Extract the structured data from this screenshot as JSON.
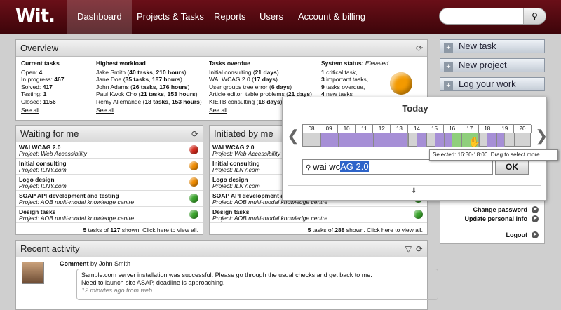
{
  "header": {
    "logo": "Wit.",
    "nav": [
      "Dashboard",
      "Projects & Tasks",
      "Reports",
      "Users",
      "Account & billing"
    ],
    "active_nav": "Dashboard",
    "search_placeholder": ""
  },
  "overview": {
    "title": "Overview",
    "current": {
      "heading": "Current tasks",
      "lines": [
        [
          "Open: ",
          "4"
        ],
        [
          "In progress: ",
          "467"
        ],
        [
          "Solved: ",
          "417"
        ],
        [
          "Testing: ",
          "1"
        ],
        [
          "Closed: ",
          "1156"
        ]
      ],
      "see_all": "See all"
    },
    "workload": {
      "heading": "Highest workload",
      "lines": [
        [
          "Jake Smith (",
          "40 tasks",
          ", ",
          "210 hours",
          ")"
        ],
        [
          "Jane Doe (",
          "35 tasks",
          ", ",
          "187 hours",
          ")"
        ],
        [
          "John Adams (",
          "26 tasks",
          ", ",
          "176 hours",
          ")"
        ],
        [
          "Paul Kwok Cho (",
          "21 tasks",
          ", ",
          "153 hours",
          ")"
        ],
        [
          "Remy Allemande (",
          "18 tasks",
          ", ",
          "153 hours",
          ")"
        ]
      ],
      "see_all": "See all"
    },
    "overdue": {
      "heading": "Tasks overdue",
      "lines": [
        [
          "Initial consulting (",
          "21 days",
          ")"
        ],
        [
          "WAI WCAG 2.0 (",
          "17 days",
          ")"
        ],
        [
          "User groups tree error (",
          "6 days",
          ")"
        ],
        [
          "Article editor: table problems (",
          "21 days",
          ")"
        ],
        [
          "KIETB consulting (",
          "18 days",
          ")"
        ]
      ],
      "see_all": "See all"
    },
    "system": {
      "heading": "System status: ",
      "status": "Elevated",
      "lines": [
        [
          "1",
          " critical task,"
        ],
        [
          "3",
          " important tasks,"
        ],
        [
          "9",
          " tasks overdue,"
        ],
        [
          "4",
          " new tasks"
        ]
      ],
      "color": "#f39a00"
    }
  },
  "waiting": {
    "title": "Waiting for me",
    "items": [
      {
        "title": "WAI WCAG 2.0",
        "project": "Project: Web Accessibility",
        "color": "#d52b1e"
      },
      {
        "title": "Initial consulting",
        "project": "Project: ILNY.com",
        "color": "#f08c00"
      },
      {
        "title": "Logo design",
        "project": "Project: ILNY.com",
        "color": "#f08c00"
      },
      {
        "title": "SOAP API development and testing",
        "project": "Project: AOB multi-modal knowledge centre",
        "color": "#3aa52c"
      },
      {
        "title": "Design tasks",
        "project": "Project: AOB multi-modal knowledge centre",
        "color": "#3aa52c"
      }
    ],
    "footer": [
      "5",
      " tasks of ",
      "127",
      " shown. Click here to view all."
    ]
  },
  "initiated": {
    "title": "Initiated by me",
    "items": [
      {
        "title": "WAI WCAG 2.0",
        "project": "Project: Web Accessibility",
        "color": "#d52b1e"
      },
      {
        "title": "Initial consulting",
        "project": "Project: ILNY.com",
        "color": "#f08c00"
      },
      {
        "title": "Logo design",
        "project": "Project: ILNY.com",
        "color": "#f08c00"
      },
      {
        "title": "SOAP API development a",
        "project": "Project: AOB multi-modal knowledge centre",
        "color": "#3aa52c"
      },
      {
        "title": "Design tasks",
        "project": "Project: AOB multi-modal knowledge centre",
        "color": "#3aa52c"
      }
    ],
    "footer": [
      "5",
      " tasks of ",
      "288",
      " shown. Click here to view all."
    ]
  },
  "sidebar": {
    "buttons": [
      "New task",
      "New project",
      "Log your work"
    ],
    "account_links": [
      "Change password",
      "Update personal info",
      "Logout"
    ]
  },
  "popup": {
    "title": "Today",
    "hours": [
      "08",
      "09",
      "10",
      "11",
      "12",
      "13",
      "14",
      "15",
      "16",
      "17",
      "18",
      "19",
      "20"
    ],
    "segments": [
      {
        "from": 9,
        "to": 14,
        "state": "busy"
      },
      {
        "from": 14.5,
        "to": 15,
        "state": "busy"
      },
      {
        "from": 15.5,
        "to": 16.5,
        "state": "busy"
      },
      {
        "from": 16.5,
        "to": 18,
        "state": "selected"
      },
      {
        "from": 18.5,
        "to": 19.5,
        "state": "busy"
      }
    ],
    "busy_color": "#a68fd6",
    "selected_color": "#8fcf7c",
    "tooltip": "Selected: 16:30-18:00. Drag to select more.",
    "input_typed": "wai wc",
    "input_suggest": "AG 2.0",
    "ok": "OK"
  },
  "recent": {
    "title": "Recent activity",
    "label": "Comment",
    "by": " by John Smith",
    "text1": "Sample.com server installation was successful. Please go through the usual checks and get back to me.",
    "text2": "Need to launch site ASAP, deadline is approaching.",
    "time": "12 minutes ago from web"
  }
}
